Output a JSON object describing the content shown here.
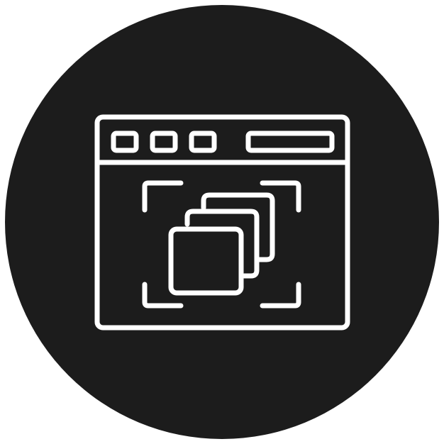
{
  "icon": {
    "name": "browser-window-stacked-layers-icon",
    "colors": {
      "page_background": "#ffffff",
      "circle_fill": "#1c1c1c",
      "line_stroke": "#ffffff"
    },
    "window_dots": 3,
    "stacked_layers": 3,
    "focus_corners": 4
  }
}
